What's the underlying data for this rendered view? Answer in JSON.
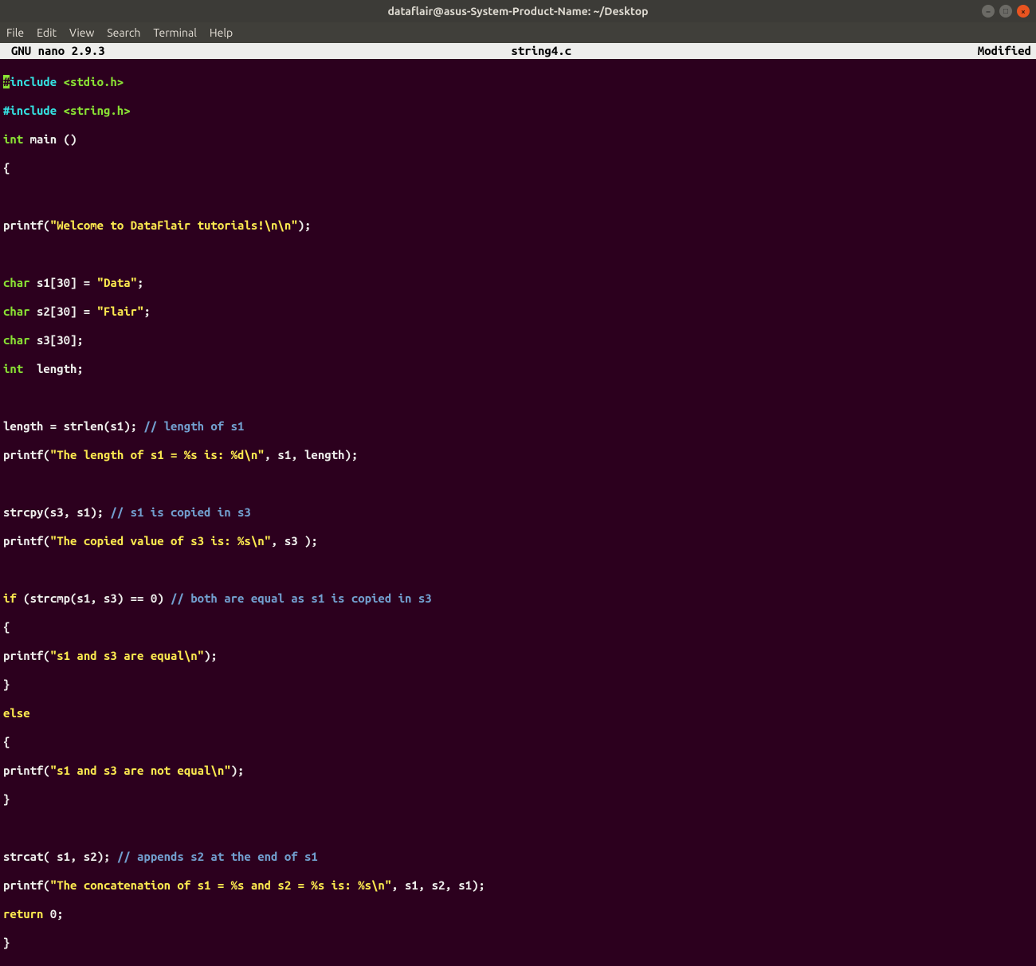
{
  "window": {
    "title": "dataflair@asus-System-Product-Name: ~/Desktop"
  },
  "menu": {
    "file": "File",
    "edit": "Edit",
    "view": "View",
    "search": "Search",
    "terminal": "Terminal",
    "help": "Help"
  },
  "nano": {
    "version": "GNU nano 2.9.3",
    "filename": "string4.c",
    "status": "Modified"
  },
  "code": {
    "l1a": "#",
    "l1b": "include ",
    "l1c": "<stdio.h>",
    "l2a": "#include ",
    "l2b": "<string.h>",
    "l3a": "int",
    "l3b": " main ()",
    "l4": "{",
    "l6a": "printf(",
    "l6b": "\"Welcome to DataFlair tutorials!\\n\\n\"",
    "l6c": ");",
    "l8a": "char",
    "l8b": " s1[30] = ",
    "l8c": "\"Data\"",
    "l8d": ";",
    "l9a": "char",
    "l9b": " s2[30] = ",
    "l9c": "\"Flair\"",
    "l9d": ";",
    "l10a": "char",
    "l10b": " s3[30];",
    "l11a": "int",
    "l11b": "  length;",
    "l13a": "length = strlen(s1); ",
    "l13b": "// length of s1",
    "l14a": "printf(",
    "l14b": "\"The length of s1 = %s is: %d\\n\"",
    "l14c": ", s1, length);",
    "l16a": "strcpy(s3, s1); ",
    "l16b": "// s1 is copied in s3",
    "l17a": "printf(",
    "l17b": "\"The copied value of s3 is: %s\\n\"",
    "l17c": ", s3 );",
    "l19a": "if",
    "l19b": " (strcmp(s1, s3) == 0) ",
    "l19c": "// both are equal as s1 is copied in s3",
    "l20": "{",
    "l21a": "printf(",
    "l21b": "\"s1 and s3 are equal\\n\"",
    "l21c": ");",
    "l22": "}",
    "l23": "else",
    "l24": "{",
    "l25a": "printf(",
    "l25b": "\"s1 and s3 are not equal\\n\"",
    "l25c": ");",
    "l26": "}",
    "l28a": "strcat( s1, s2); ",
    "l28b": "// appends s2 at the end of s1",
    "l29a": "printf(",
    "l29b": "\"The concatenation of s1 = %s and s2 = %s is: %s\\n\"",
    "l29c": ", s1, s2, s1);",
    "l30a": "return",
    "l30b": " 0;",
    "l31": "}"
  }
}
